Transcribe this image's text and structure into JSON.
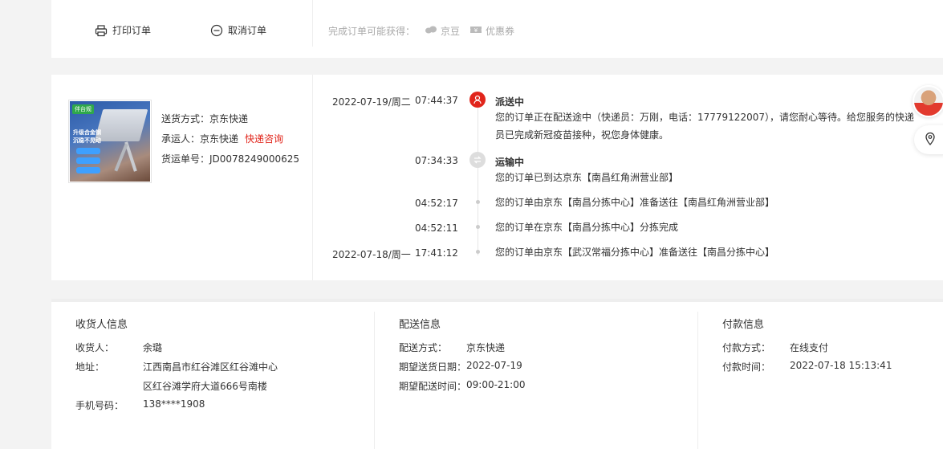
{
  "actions": {
    "print_label": "打印订单",
    "cancel_label": "取消订单"
  },
  "rewards": {
    "prefix": "完成订单可能获得：",
    "beans": "京豆",
    "coupon": "优惠券"
  },
  "shipment": {
    "method": "送货方式：京东快递",
    "carrier_prefix": "承运人：京东快递",
    "carrier_link": "快递咨询",
    "tracking": "货运单号：JD0078249000625"
  },
  "timeline": [
    {
      "date": "2022-07-19/周二",
      "time": "07:44:37",
      "status": "派送中",
      "desc1": "您的订单正在配送途中（快递员：万刚，电话：17779122007），请您耐心等待。给您服务的快递",
      "desc2": "员已完成新冠疫苗接种，祝您身体健康。"
    },
    {
      "date": "",
      "time": "07:34:33",
      "status": "运输中",
      "desc1": "您的订单已到达京东【南昌红角洲营业部】"
    },
    {
      "date": "",
      "time": "04:52:17",
      "desc1": "您的订单由京东【南昌分拣中心】准备送往【南昌红角洲营业部】"
    },
    {
      "date": "",
      "time": "04:52:11",
      "desc1": "您的订单在京东【南昌分拣中心】分拣完成"
    },
    {
      "date": "2022-07-18/周一",
      "time": "17:41:12",
      "desc1": "您的订单由京东【武汉常福分拣中心】准备送往【南昌分拣中心】"
    }
  ],
  "receiver": {
    "title": "收货人信息",
    "name_label": "收货人：",
    "name": "余璐",
    "addr_label": "地址：",
    "addr1": "江西南昌市红谷滩区红谷滩中心",
    "addr2": "区红谷滩学府大道666号南楼",
    "phone_label": "手机号码：",
    "phone": "138****1908"
  },
  "delivery": {
    "title": "配送信息",
    "method_label": "配送方式：",
    "method": "京东快递",
    "date_label": "期望送货日期：",
    "date": "2022-07-19",
    "time_label": "期望配送时间：",
    "time": "09:00-21:00"
  },
  "payment": {
    "title": "付款信息",
    "method_label": "付款方式：",
    "method": "在线支付",
    "time_label": "付款时间：",
    "time": "2022-07-18 15:13:41"
  },
  "colors": {
    "accent_red": "#e1251b",
    "muted": "#aaaaaa"
  }
}
